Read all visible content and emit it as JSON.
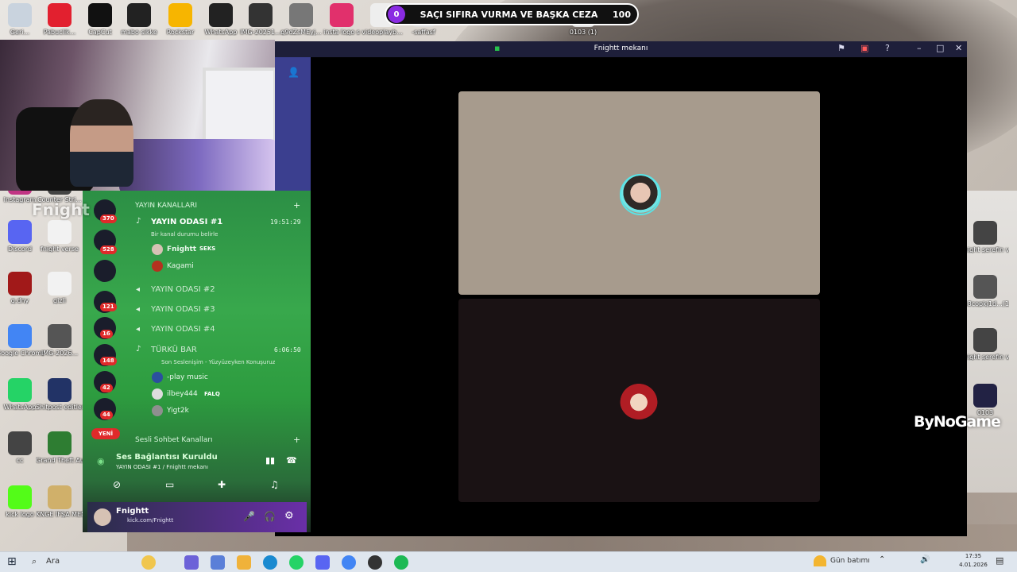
{
  "banner": {
    "left_count": "0",
    "text": "SAÇI SIFIRA VURMA VE BAŞKA CEZA",
    "right_count": "100"
  },
  "top_icons": [
    {
      "label": "Geri...",
      "color": "#c9d3de"
    },
    {
      "label": "Pabuclik...",
      "color": "#e2202f"
    },
    {
      "label": "CapCut",
      "color": "#111111"
    },
    {
      "label": "mabo sikke",
      "color": "#222222"
    },
    {
      "label": "Rockstar",
      "color": "#f7b500"
    },
    {
      "label": "WhatsApp",
      "color": "#222222"
    },
    {
      "label": "IMG-20251...",
      "color": "#333333"
    },
    {
      "label": "q9dZsMEyj...",
      "color": "#777777"
    },
    {
      "label": "insta logo s",
      "color": "#e1306c"
    },
    {
      "label": "videoplayb...",
      "color": "#eeeeee"
    },
    {
      "label": "-saffasf",
      "color": "#dddddd"
    },
    {
      "label": "0103 (1)",
      "color": "#dddddd"
    }
  ],
  "left_icons": [
    {
      "label": "Instagram",
      "color": "#c13584"
    },
    {
      "label": "Counter Stri...",
      "color": "#444444"
    },
    {
      "label": "Discord",
      "color": "#5865f2"
    },
    {
      "label": "fnight verse",
      "color": "#f2f2f2"
    },
    {
      "label": "g.dny",
      "color": "#a11919"
    },
    {
      "label": "gizli",
      "color": "#f2f2f2"
    },
    {
      "label": "Google Chrome",
      "color": "#4285f4"
    },
    {
      "label": "IMG-2026...",
      "color": "#555555"
    },
    {
      "label": "WhatsApp",
      "color": "#25d366"
    },
    {
      "label": "Shitpost editler...",
      "color": "#223366"
    },
    {
      "label": "cc",
      "color": "#444444"
    },
    {
      "label": "Grand Theft Auto V",
      "color": "#2e7d32"
    },
    {
      "label": "kick logo",
      "color": "#53fc18"
    },
    {
      "label": "KNGE İFŞA MEN",
      "color": "#d0b06a"
    }
  ],
  "right_icons": [
    {
      "label": "fnight şerefin varmı şerefin",
      "color": "#444444"
    },
    {
      "label": "8.8copkj1d...(1)",
      "color": "#555555"
    },
    {
      "label": "fnight şerefin varmı şerefin",
      "color": "#444444"
    },
    {
      "label": "0103",
      "color": "#222244"
    }
  ],
  "watermark": "Fnight",
  "bynogame": "ByNoGame",
  "window": {
    "title": "Fnightt mekanı"
  },
  "servers": {
    "badges": [
      "370",
      "528",
      "121",
      "16",
      "148",
      "42",
      "44"
    ],
    "new_label": "YENİ"
  },
  "channels": {
    "category": "YAYIN KANALLARI",
    "room1": {
      "name": "YAYIN ODASI #1",
      "time": "19:51:29",
      "status": "Bir kanal durumu belirle"
    },
    "users1": [
      {
        "name": "Fnightt",
        "tag": "SEKS"
      },
      {
        "name": "Kagami",
        "tag": ""
      }
    ],
    "room2": "YAYIN ODASI #2",
    "room3": "YAYIN ODASI #3",
    "room4": "YAYIN ODASI #4",
    "turku": {
      "name": "TÜRKÜ BAR",
      "time": "6:06:50",
      "status": "Son Seslenişim - Yüzyüzeyken Konuşuruz"
    },
    "users2": [
      {
        "name": "-play music",
        "tag": ""
      },
      {
        "name": "ilbey444",
        "tag": "FALQ"
      },
      {
        "name": "Yigt2k",
        "tag": ""
      }
    ],
    "category2": "Sesli Sohbet Kanalları"
  },
  "voice": {
    "status": "Ses Bağlantısı Kuruldu",
    "location": "YAYIN ODASI #1 / Fnightt mekanı"
  },
  "userbar": {
    "name": "Fnightt",
    "status": "kick.com/Fnightt"
  },
  "taskbar": {
    "search": "Ara",
    "weather": "Gün batımı",
    "time": "17:35",
    "date": "4.01.2026"
  }
}
